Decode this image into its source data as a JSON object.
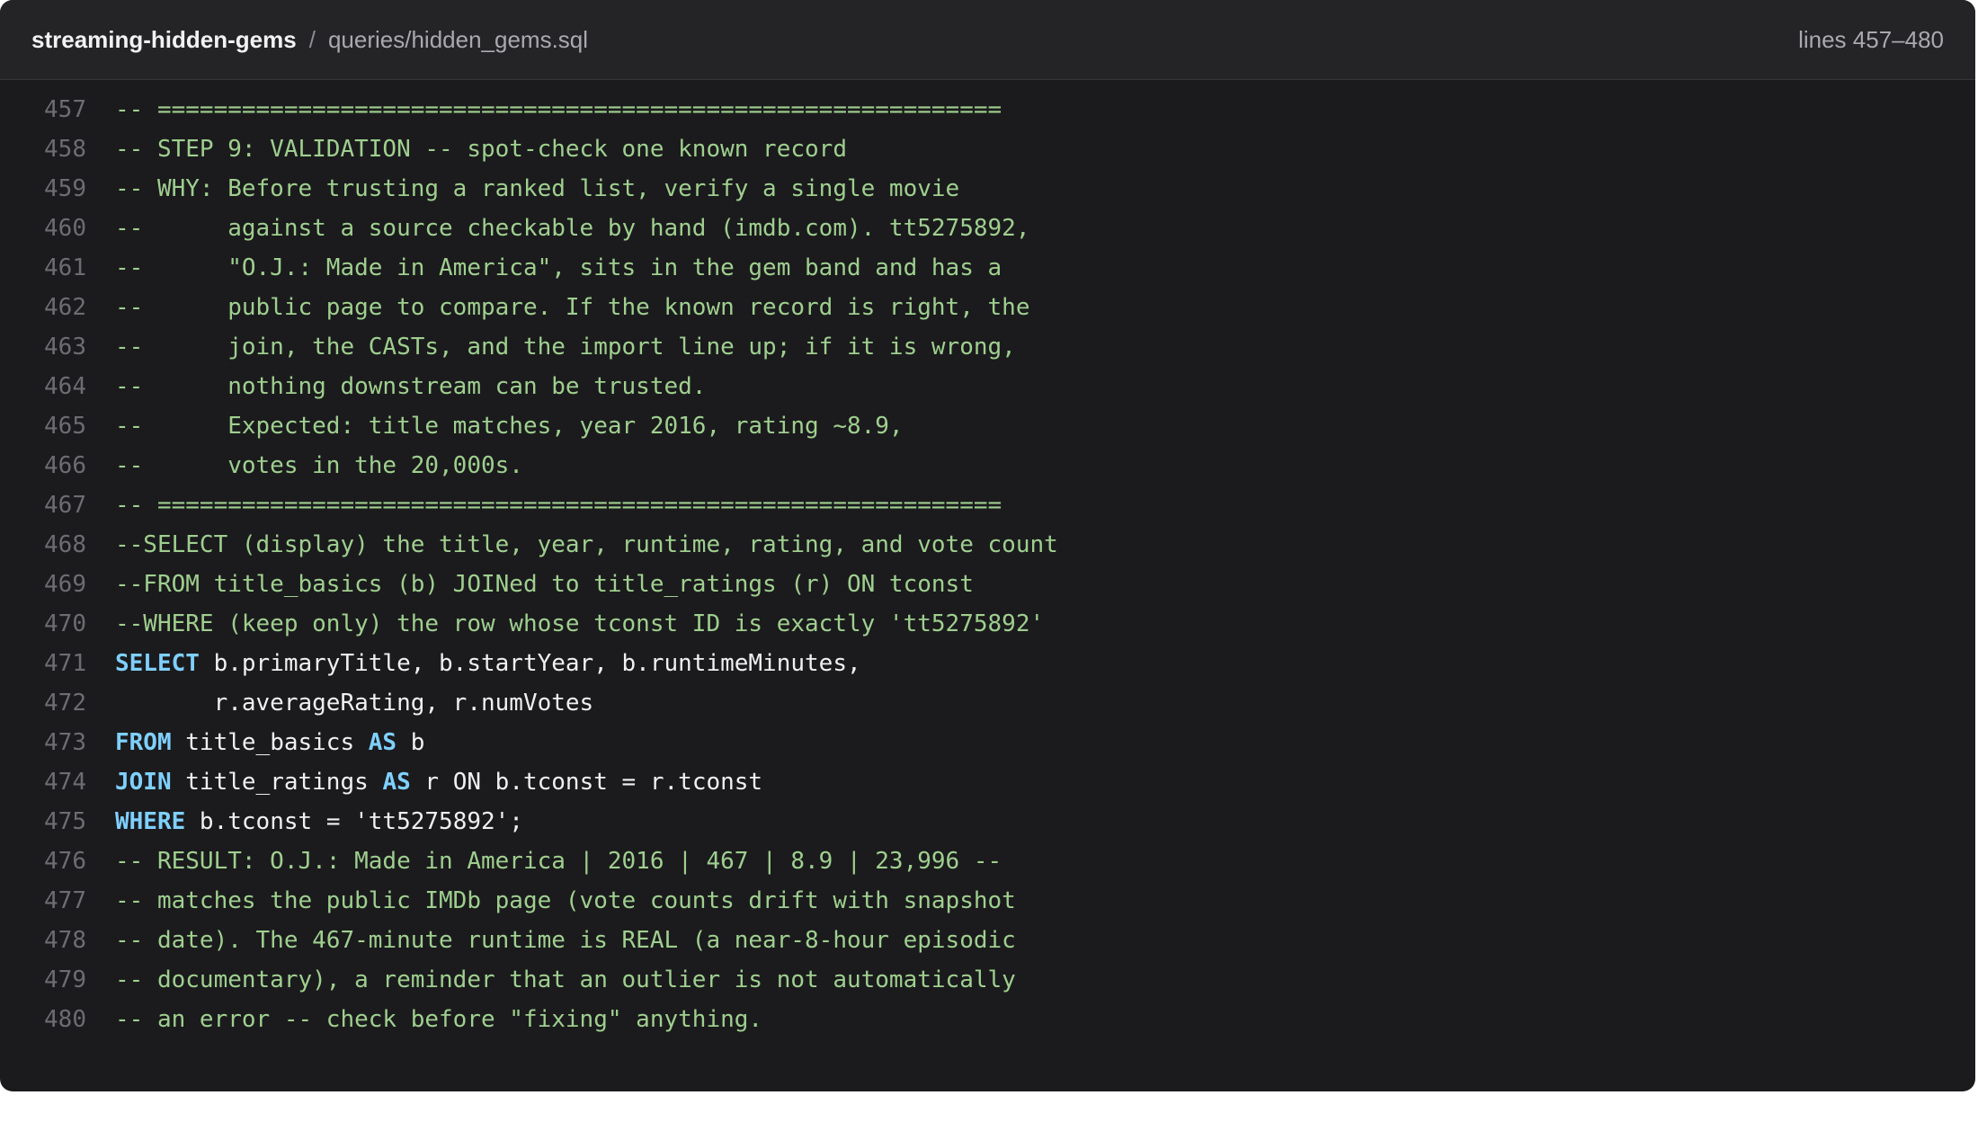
{
  "header": {
    "repo": "streaming-hidden-gems",
    "separator": "/",
    "file_path": "queries/hidden_gems.sql",
    "line_range": "lines 457–480"
  },
  "lines": [
    {
      "num": "457",
      "tokens": [
        {
          "t": "cm",
          "v": "-- ============================================================"
        }
      ]
    },
    {
      "num": "458",
      "tokens": [
        {
          "t": "cm",
          "v": "-- STEP 9: VALIDATION -- spot-check one known record"
        }
      ]
    },
    {
      "num": "459",
      "tokens": [
        {
          "t": "cm",
          "v": "-- WHY: Before trusting a ranked list, verify a single movie"
        }
      ]
    },
    {
      "num": "460",
      "tokens": [
        {
          "t": "cm",
          "v": "--      against a source checkable by hand (imdb.com). tt5275892,"
        }
      ]
    },
    {
      "num": "461",
      "tokens": [
        {
          "t": "cm",
          "v": "--      \"O.J.: Made in America\", sits in the gem band and has a"
        }
      ]
    },
    {
      "num": "462",
      "tokens": [
        {
          "t": "cm",
          "v": "--      public page to compare. If the known record is right, the"
        }
      ]
    },
    {
      "num": "463",
      "tokens": [
        {
          "t": "cm",
          "v": "--      join, the CASTs, and the import line up; if it is wrong,"
        }
      ]
    },
    {
      "num": "464",
      "tokens": [
        {
          "t": "cm",
          "v": "--      nothing downstream can be trusted."
        }
      ]
    },
    {
      "num": "465",
      "tokens": [
        {
          "t": "cm",
          "v": "--      Expected: title matches, year 2016, rating ~8.9,"
        }
      ]
    },
    {
      "num": "466",
      "tokens": [
        {
          "t": "cm",
          "v": "--      votes in the 20,000s."
        }
      ]
    },
    {
      "num": "467",
      "tokens": [
        {
          "t": "cm",
          "v": "-- ============================================================"
        }
      ]
    },
    {
      "num": "468",
      "tokens": [
        {
          "t": "cm",
          "v": "--SELECT (display) the title, year, runtime, rating, and vote count"
        }
      ]
    },
    {
      "num": "469",
      "tokens": [
        {
          "t": "cm",
          "v": "--FROM title_basics (b) JOINed to title_ratings (r) ON tconst"
        }
      ]
    },
    {
      "num": "470",
      "tokens": [
        {
          "t": "cm",
          "v": "--WHERE (keep only) the row whose tconst ID is exactly 'tt5275892'"
        }
      ]
    },
    {
      "num": "471",
      "tokens": [
        {
          "t": "kw",
          "v": "SELECT"
        },
        {
          "t": "tx",
          "v": " b.primaryTitle, b.startYear, b.runtimeMinutes,"
        }
      ]
    },
    {
      "num": "472",
      "tokens": [
        {
          "t": "tx",
          "v": "       r.averageRating, r.numVotes"
        }
      ]
    },
    {
      "num": "473",
      "tokens": [
        {
          "t": "kw",
          "v": "FROM"
        },
        {
          "t": "tx",
          "v": " title_basics "
        },
        {
          "t": "kw",
          "v": "AS"
        },
        {
          "t": "tx",
          "v": " b"
        }
      ]
    },
    {
      "num": "474",
      "tokens": [
        {
          "t": "kw",
          "v": "JOIN"
        },
        {
          "t": "tx",
          "v": " title_ratings "
        },
        {
          "t": "kw",
          "v": "AS"
        },
        {
          "t": "tx",
          "v": " r ON b.tconst = r.tconst"
        }
      ]
    },
    {
      "num": "475",
      "tokens": [
        {
          "t": "kw",
          "v": "WHERE"
        },
        {
          "t": "tx",
          "v": " b.tconst = 'tt5275892';"
        }
      ]
    },
    {
      "num": "476",
      "tokens": [
        {
          "t": "cm",
          "v": "-- RESULT: O.J.: Made in America | 2016 | 467 | 8.9 | 23,996 --"
        }
      ]
    },
    {
      "num": "477",
      "tokens": [
        {
          "t": "cm",
          "v": "-- matches the public IMDb page (vote counts drift with snapshot"
        }
      ]
    },
    {
      "num": "478",
      "tokens": [
        {
          "t": "cm",
          "v": "-- date). The 467-minute runtime is REAL (a near-8-hour episodic"
        }
      ]
    },
    {
      "num": "479",
      "tokens": [
        {
          "t": "cm",
          "v": "-- documentary), a reminder that an outlier is not automatically"
        }
      ]
    },
    {
      "num": "480",
      "tokens": [
        {
          "t": "cm",
          "v": "-- an error -- check before \"fixing\" anything."
        }
      ]
    }
  ]
}
